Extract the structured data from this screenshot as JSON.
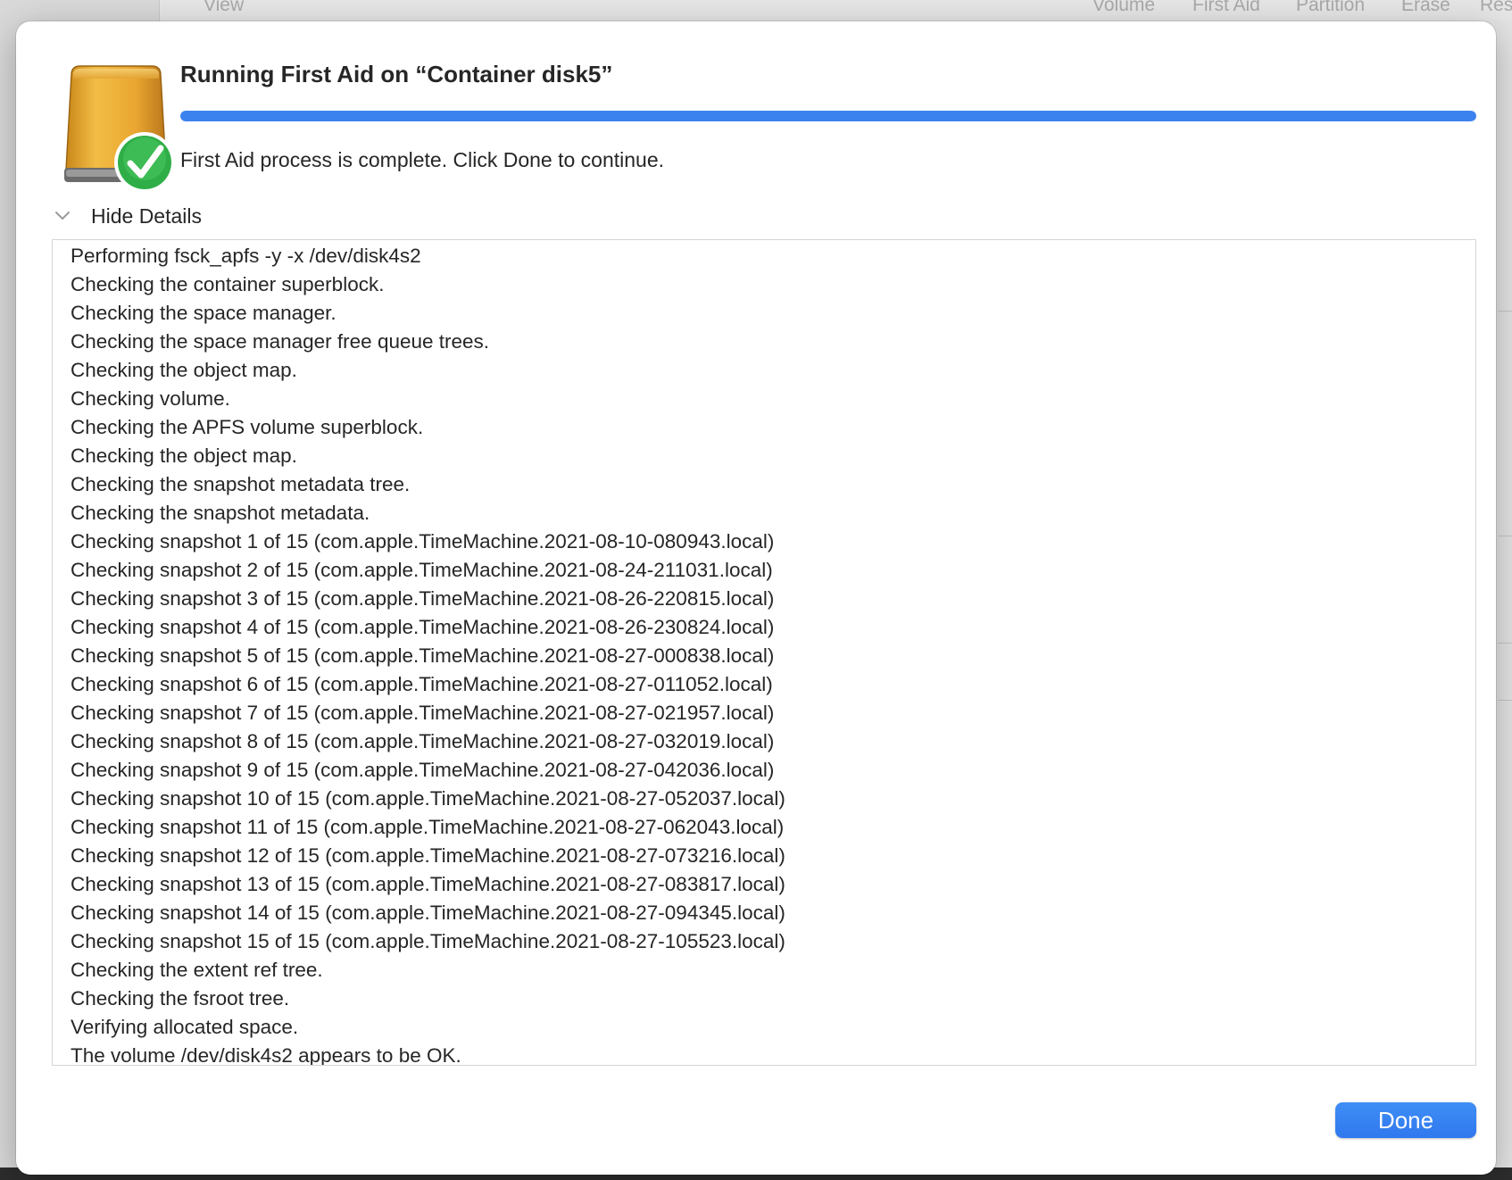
{
  "background": {
    "toolbar_items": [
      "View",
      "Volume",
      "First Aid",
      "Partition",
      "Erase",
      "Res"
    ]
  },
  "dialog": {
    "title": "Running First Aid on “Container disk5”",
    "progress_percent": 100,
    "status": "First Aid process is complete. Click Done to continue.",
    "details_toggle_label": "Hide Details",
    "log": [
      "Performing fsck_apfs -y -x /dev/disk4s2",
      "Checking the container superblock.",
      "Checking the space manager.",
      "Checking the space manager free queue trees.",
      "Checking the object map.",
      "Checking volume.",
      "Checking the APFS volume superblock.",
      "Checking the object map.",
      "Checking the snapshot metadata tree.",
      "Checking the snapshot metadata.",
      "Checking snapshot 1 of 15 (com.apple.TimeMachine.2021-08-10-080943.local)",
      "Checking snapshot 2 of 15 (com.apple.TimeMachine.2021-08-24-211031.local)",
      "Checking snapshot 3 of 15 (com.apple.TimeMachine.2021-08-26-220815.local)",
      "Checking snapshot 4 of 15 (com.apple.TimeMachine.2021-08-26-230824.local)",
      "Checking snapshot 5 of 15 (com.apple.TimeMachine.2021-08-27-000838.local)",
      "Checking snapshot 6 of 15 (com.apple.TimeMachine.2021-08-27-011052.local)",
      "Checking snapshot 7 of 15 (com.apple.TimeMachine.2021-08-27-021957.local)",
      "Checking snapshot 8 of 15 (com.apple.TimeMachine.2021-08-27-032019.local)",
      "Checking snapshot 9 of 15 (com.apple.TimeMachine.2021-08-27-042036.local)",
      "Checking snapshot 10 of 15 (com.apple.TimeMachine.2021-08-27-052037.local)",
      "Checking snapshot 11 of 15 (com.apple.TimeMachine.2021-08-27-062043.local)",
      "Checking snapshot 12 of 15 (com.apple.TimeMachine.2021-08-27-073216.local)",
      "Checking snapshot 13 of 15 (com.apple.TimeMachine.2021-08-27-083817.local)",
      "Checking snapshot 14 of 15 (com.apple.TimeMachine.2021-08-27-094345.local)",
      "Checking snapshot 15 of 15 (com.apple.TimeMachine.2021-08-27-105523.local)",
      "Checking the extent ref tree.",
      "Checking the fsroot tree.",
      "Verifying allocated space.",
      "The volume /dev/disk4s2 appears to be OK."
    ],
    "done_label": "Done"
  },
  "icons": {
    "drive": "external-drive-icon",
    "badge": "checkmark-badge-icon",
    "toggle": "chevron-down-icon"
  },
  "colors": {
    "accent": "#3b82ef",
    "drive_gold": "#e7a92c",
    "badge_green": "#30b545"
  }
}
